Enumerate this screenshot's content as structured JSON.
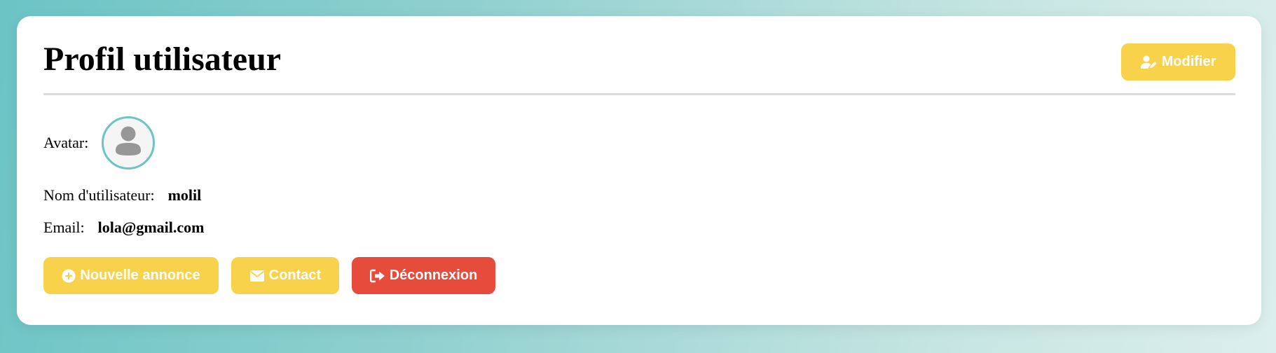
{
  "page": {
    "title": "Profil utilisateur",
    "edit_button": "Modifier"
  },
  "profile": {
    "avatar_label": "Avatar:",
    "username_label": "Nom d'utilisateur:",
    "username": "molil",
    "email_label": "Email:",
    "email": "lola@gmail.com"
  },
  "actions": {
    "new_listing": "Nouvelle annonce",
    "contact": "Contact",
    "logout": "Déconnexion"
  },
  "icons": {
    "edit": "user-edit-icon",
    "avatar": "user-placeholder-icon",
    "new_listing": "plus-circle-icon",
    "contact": "envelope-icon",
    "logout": "sign-out-icon"
  },
  "colors": {
    "accent_yellow": "#f8d24a",
    "danger_red": "#e64b3c",
    "avatar_border": "#6cc4c5",
    "avatar_icon": "#979797"
  }
}
